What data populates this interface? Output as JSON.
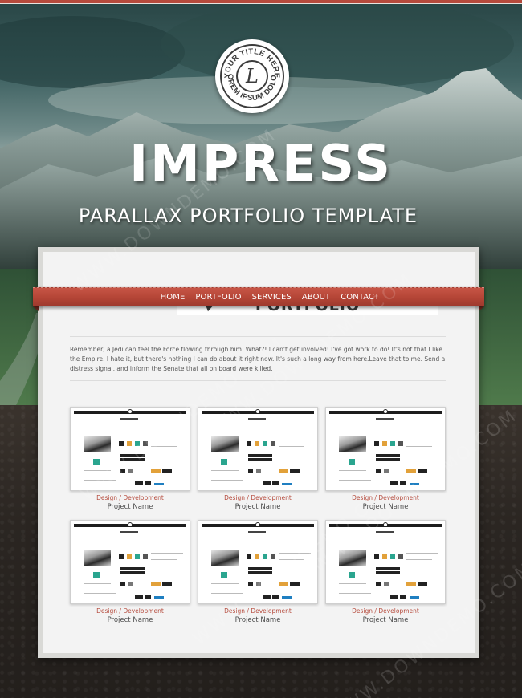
{
  "badge": {
    "top_text": "YOUR TITLE HERE",
    "bottom_text": "LOREM IPSUM DOLOR",
    "monogram": "L"
  },
  "hero": {
    "title": "IMPRESS",
    "subtitle": "PARALLAX PORTFOLIO TEMPLATE"
  },
  "nav": {
    "items": [
      "HOME",
      "PORTFOLIO",
      "SERVICES",
      "ABOUT",
      "CONTACT"
    ]
  },
  "section": {
    "heading": "PORTFOLIO",
    "intro": "Remember, a Jedi can feel the Force flowing through him. What?! I can't get involved! I've got work to do! It's not that I like the Empire. I hate it, but there's nothing I can do about it right now. It's such a long way from here.Leave that to me. Send a distress signal, and inform the Senate that all on board were killed."
  },
  "portfolio": {
    "items": [
      {
        "category": "Design / Development",
        "name": "Project Name"
      },
      {
        "category": "Design / Development",
        "name": "Project Name"
      },
      {
        "category": "Design / Development",
        "name": "Project Name"
      },
      {
        "category": "Design / Development",
        "name": "Project Name"
      },
      {
        "category": "Design / Development",
        "name": "Project Name"
      },
      {
        "category": "Design / Development",
        "name": "Project Name"
      }
    ]
  },
  "watermark": "WWW.DOWNDEMO.COM",
  "colors": {
    "accent": "#b64a3c",
    "panel": "#f3f3f3",
    "text": "#555555"
  }
}
